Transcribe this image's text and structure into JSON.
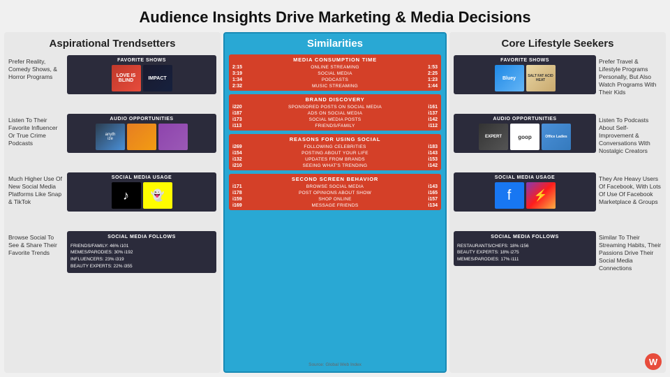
{
  "title": "Audience Insights Drive Marketing & Media Decisions",
  "left": {
    "panel_title": "Aspirational Trendsetters",
    "sections": [
      {
        "id": "fav-shows-left",
        "side_text": "Prefer Reality, Comedy Shows, & Horror Programs",
        "card_title": "FAVORITE SHOWS",
        "images": [
          "love",
          "impact"
        ]
      },
      {
        "id": "audio-left",
        "side_text": "Listen To Their Favorite Influencer Or True Crime Podcasts",
        "card_title": "AUDIO OPPORTUNITIES",
        "images": [
          "podcast1",
          "podcast2",
          "podcast3"
        ]
      },
      {
        "id": "social-usage-left",
        "side_text": "Much Higher Use Of New Social Media Platforms Like Snap & TikTok",
        "card_title": "SOCIAL MEDIA USAGE",
        "images": [
          "tiktok",
          "snap"
        ]
      }
    ],
    "follows": {
      "title": "SOCIAL MEDIA FOLLOWS",
      "side_text": "Browse Social To See & Share Their Favorite Trends",
      "items": [
        "FRIENDS/FAMILY: 46% i101",
        "MEMES/PARODIES: 30% i192",
        "INFLUENCERS: 23% i319",
        "BEAUTY EXPERTS: 22% i355"
      ]
    }
  },
  "center": {
    "title": "Similarities",
    "sections": [
      {
        "id": "media-consumption",
        "title": "MEDIA CONSUMPTION TIME",
        "rows": [
          {
            "left": "2:15",
            "label": "ONLINE STREAMING",
            "right": "1:53"
          },
          {
            "left": "3:19",
            "label": "SOCIAL MEDIA",
            "right": "2:25"
          },
          {
            "left": "1:34",
            "label": "PODCASTS",
            "right": "1:23"
          },
          {
            "left": "2:32",
            "label": "MUSIC STREAMING",
            "right": "1:44"
          }
        ]
      },
      {
        "id": "brand-discovery",
        "title": "BRAND DISCOVERY",
        "rows": [
          {
            "left": "i220",
            "label": "SPONSORED POSTS ON SOCIAL MEDIA",
            "right": "i161"
          },
          {
            "left": "i187",
            "label": "ADS ON SOCIAL MEDIA",
            "right": "i137"
          },
          {
            "left": "i173",
            "label": "SOCIAL MEDIA POSTS",
            "right": "i142"
          },
          {
            "left": "i113",
            "label": "FRIENDS/FAMILY",
            "right": "i112"
          }
        ]
      },
      {
        "id": "reasons-social",
        "title": "REASONS FOR USING SOCIAL",
        "rows": [
          {
            "left": "i269",
            "label": "FOLLOWING CELEBRITIES",
            "right": "i183"
          },
          {
            "left": "i154",
            "label": "POSTING ABOUT YOUR LIFE",
            "right": "i143"
          },
          {
            "left": "i132",
            "label": "UPDATES FROM BRANDS",
            "right": "i153"
          },
          {
            "left": "i210",
            "label": "SEEING WHAT'S TRENDING",
            "right": "i142"
          }
        ]
      },
      {
        "id": "second-screen",
        "title": "SECOND SCREEN BEHAVIOR",
        "rows": [
          {
            "left": "i171",
            "label": "BROWSE SOCIAL MEDIA",
            "right": "i143"
          },
          {
            "left": "i178",
            "label": "POST OPINIONS ABOUT SHOW",
            "right": "i165"
          },
          {
            "left": "i159",
            "label": "SHOP ONLINE",
            "right": "i157"
          },
          {
            "left": "i169",
            "label": "MESSAGE FRIENDS",
            "right": "i134"
          }
        ]
      }
    ],
    "source": "Source: Global Web Index"
  },
  "right": {
    "panel_title": "Core Lifestyle Seekers",
    "sections": [
      {
        "id": "fav-shows-right",
        "card_title": "FAVORITE SHOWS",
        "images": [
          "bluey",
          "saltfat"
        ],
        "side_text": "Prefer Travel & Lifestyle Programs Personally, But Also Watch Programs With Their Kids"
      },
      {
        "id": "audio-right",
        "card_title": "AUDIO OPPORTUNITIES",
        "images": [
          "expert",
          "goop",
          "officeladies"
        ],
        "side_text": "Listen To Podcasts About Self-Improvement & Conversations With Nostalgic Creators"
      },
      {
        "id": "social-usage-right",
        "card_title": "SOCIAL MEDIA USAGE",
        "images": [
          "fb",
          "mess"
        ],
        "side_text": "They Are Heavy Users Of Facebook, With Lots Of Use Of Facebook Marketplace & Groups"
      }
    ],
    "follows": {
      "title": "SOCIAL MEDIA FOLLOWS",
      "side_text": "Similar To Their Streaming Habits, Their Passions Drive Their Social Media Connections",
      "items": [
        "RESTAURANTS/CHEFS: 18% i156",
        "BEAUTY EXPERTS: 18% i275",
        "MEMES/PARODIES: 17% i111"
      ]
    }
  }
}
